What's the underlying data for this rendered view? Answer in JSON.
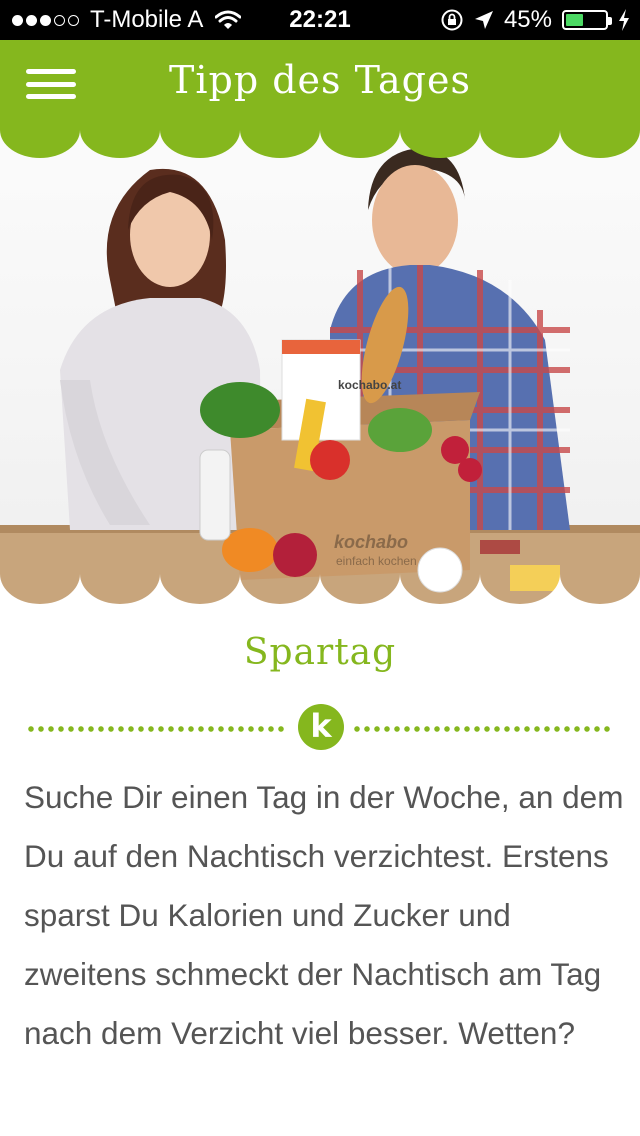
{
  "status_bar": {
    "carrier": "T-Mobile A",
    "time": "22:21",
    "battery_percent": "45%",
    "battery_level": 0.45,
    "signal_bars_filled": 3,
    "signal_bars_total": 5,
    "icons": [
      "wifi-icon",
      "rotation-lock-icon",
      "location-arrow-icon",
      "battery-icon",
      "charging-bolt-icon"
    ]
  },
  "header": {
    "title": "Tipp des Tages",
    "background_color": "#85b71e",
    "menu_icon": "hamburger-menu-icon"
  },
  "hero": {
    "image_description_icon": "hero-photo",
    "box_brand": "kochabo",
    "box_tagline": "einfach kochen",
    "card_brand": "kochabo.at"
  },
  "tip": {
    "title": "Spartag",
    "logo_letter": "k",
    "body": "Suche Dir einen Tag in der Woche, an dem Du auf den Nachtisch verzichtest. Erstens sparst Du Kalorien und Zucker und zweitens schmeckt der Nachtisch am Tag nach dem Verzicht viel besser. Wetten?"
  },
  "colors": {
    "accent": "#85b71e",
    "text": "#555555",
    "status_bar_bg": "#000000",
    "battery_fill": "#4cd964"
  }
}
